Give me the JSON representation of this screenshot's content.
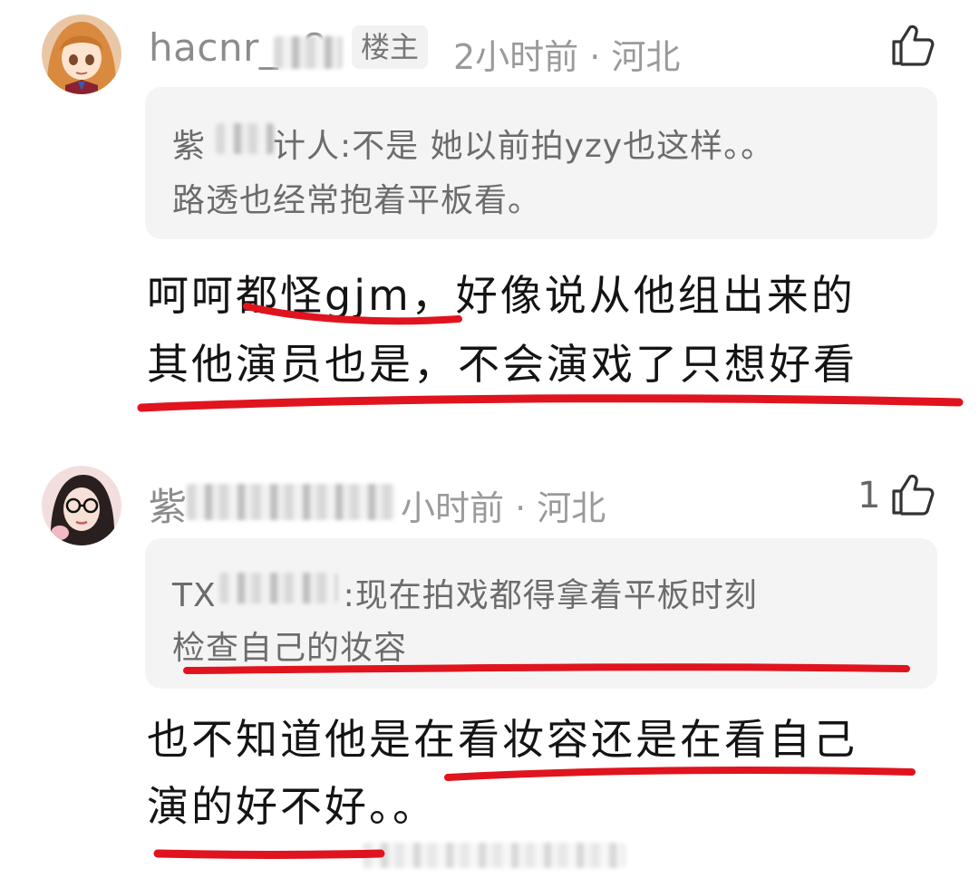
{
  "comments": [
    {
      "username": "hacnr_o8",
      "badge": "楼主",
      "meta": "2小时前 · 河北",
      "like_count": "",
      "quote": {
        "author": "紫",
        "author_tail": "计人:",
        "line1": "不是 她以前拍yzy也这样。。",
        "line2": "路透也经常抱着平板看。"
      },
      "reply_line1_pre": "呵呵",
      "reply_line1_mid": "都怪gjm，",
      "reply_line1_post": "好像说从他组出来的",
      "reply_line2": "其他演员也是，不会演戏了只想好看"
    },
    {
      "username": "紫",
      "badge": "",
      "meta": "小时前 · 河北",
      "like_count": "1",
      "quote": {
        "author": "TX",
        "author_tail": ":",
        "line1": "现在拍戏都得拿着平板时刻",
        "line2": "检查自己的妆容"
      },
      "reply_line1": "也不知道他是在看妆容还是在看自己",
      "reply_line2": "演的好不好。。"
    }
  ],
  "colors": {
    "underline": "#e0141e",
    "quote_bg": "#f4f4f4",
    "meta": "#9a9a9a"
  },
  "icons": {
    "like": "thumbs-up-icon"
  }
}
